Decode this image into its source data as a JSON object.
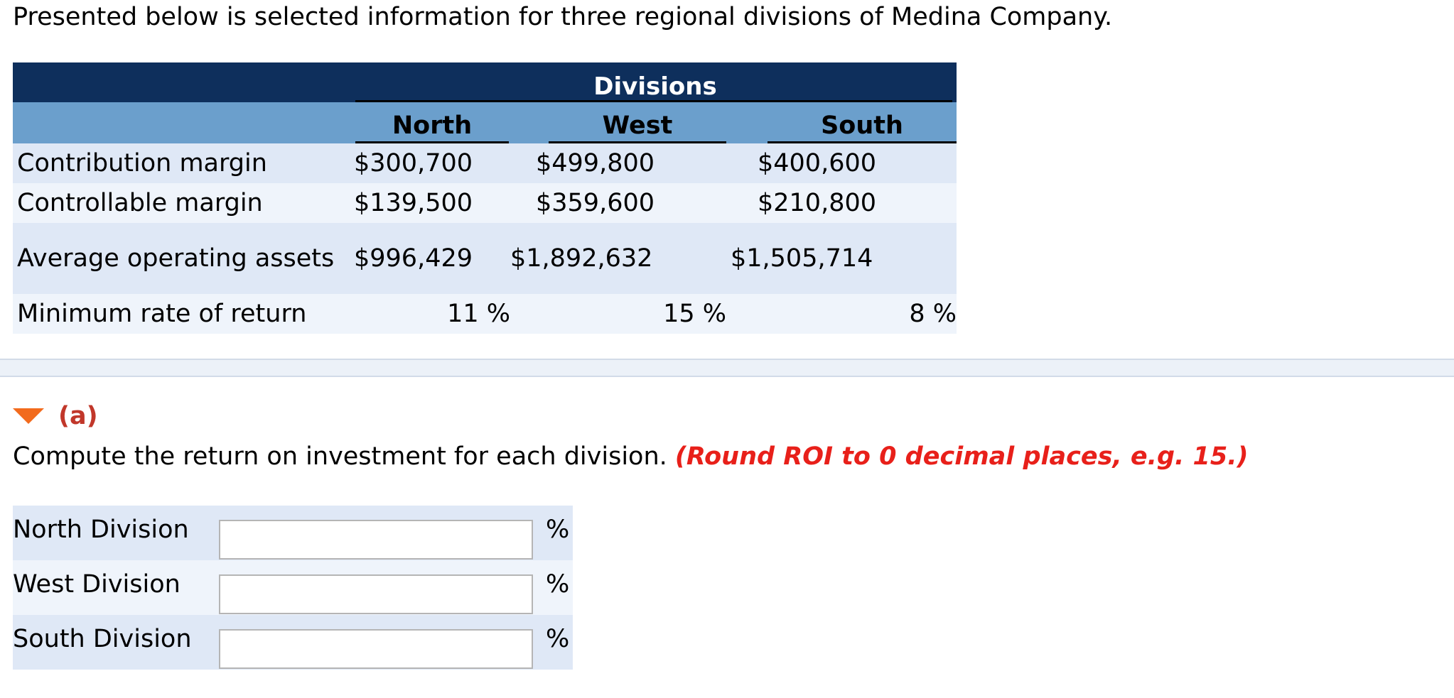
{
  "intro": "Presented below is selected information for three regional divisions of Medina Company.",
  "table": {
    "group_header": "Divisions",
    "columns": [
      "North",
      "West",
      "South"
    ],
    "rows": [
      {
        "label": "Contribution margin",
        "values": [
          "$300,700",
          "$499,800",
          "$400,600"
        ]
      },
      {
        "label": "Controllable margin",
        "values": [
          "$139,500",
          "$359,600",
          "$210,800"
        ]
      },
      {
        "label": "Average operating assets",
        "values": [
          "$996,429",
          "$1,892,632",
          "$1,505,714"
        ]
      },
      {
        "label": "Minimum rate of return",
        "values": [
          "11 %",
          "15 %",
          "8 %"
        ]
      }
    ]
  },
  "part": {
    "label": "(a)",
    "instruction": "Compute the return on investment for each division.",
    "hint": "(Round ROI to 0 decimal places, e.g. 15.)"
  },
  "answers": [
    {
      "label": "North Division",
      "value": "",
      "unit": "%"
    },
    {
      "label": "West Division",
      "value": "",
      "unit": "%"
    },
    {
      "label": "South Division",
      "value": "",
      "unit": "%"
    }
  ],
  "colors": {
    "header_dark": "#0e2f5c",
    "header_light": "#6b9fcc",
    "accent_orange": "#f26b1d",
    "hint_red": "#e8201a"
  }
}
